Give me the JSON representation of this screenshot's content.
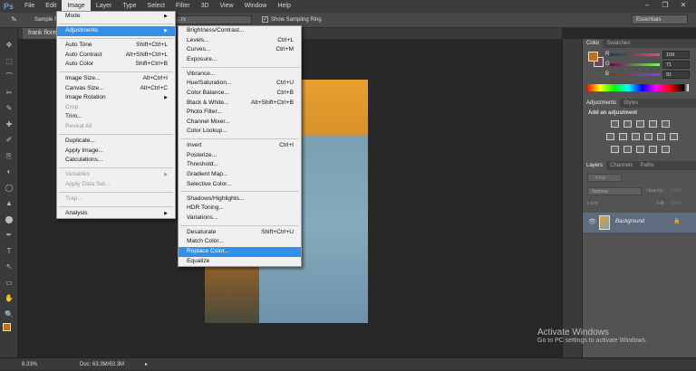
{
  "app": {
    "logo": "Ps"
  },
  "menubar": [
    "File",
    "Edit",
    "Image",
    "Layer",
    "Type",
    "Select",
    "Filter",
    "3D",
    "View",
    "Window",
    "Help"
  ],
  "options": {
    "sample_size": "Sample S",
    "sample_select": "...rs",
    "show_sampling_ring": "Show Sampling Ring",
    "workspace": "Essentials"
  },
  "document": {
    "tab": "frank flores"
  },
  "image_menu": [
    {
      "label": "Mode",
      "submenu": true
    },
    {
      "sep": true
    },
    {
      "label": "Adjustments",
      "submenu": true,
      "hl": true
    },
    {
      "sep": true
    },
    {
      "label": "Auto Tone",
      "shortcut": "Shift+Ctrl+L"
    },
    {
      "label": "Auto Contrast",
      "shortcut": "Alt+Shift+Ctrl+L"
    },
    {
      "label": "Auto Color",
      "shortcut": "Shift+Ctrl+B"
    },
    {
      "sep": true
    },
    {
      "label": "Image Size...",
      "shortcut": "Alt+Ctrl+I"
    },
    {
      "label": "Canvas Size...",
      "shortcut": "Alt+Ctrl+C"
    },
    {
      "label": "Image Rotation",
      "submenu": true
    },
    {
      "label": "Crop",
      "dis": true
    },
    {
      "label": "Trim..."
    },
    {
      "label": "Reveal All",
      "dis": true
    },
    {
      "sep": true
    },
    {
      "label": "Duplicate..."
    },
    {
      "label": "Apply Image..."
    },
    {
      "label": "Calculations..."
    },
    {
      "sep": true
    },
    {
      "label": "Variables",
      "submenu": true,
      "dis": true
    },
    {
      "label": "Apply Data Set...",
      "dis": true
    },
    {
      "sep": true
    },
    {
      "label": "Trap...",
      "dis": true
    },
    {
      "sep": true
    },
    {
      "label": "Analysis",
      "submenu": true
    }
  ],
  "adjustments_menu": [
    {
      "label": "Brightness/Contrast..."
    },
    {
      "label": "Levels...",
      "shortcut": "Ctrl+L"
    },
    {
      "label": "Curves...",
      "shortcut": "Ctrl+M"
    },
    {
      "label": "Exposure..."
    },
    {
      "sep": true
    },
    {
      "label": "Vibrance..."
    },
    {
      "label": "Hue/Saturation...",
      "shortcut": "Ctrl+U"
    },
    {
      "label": "Color Balance...",
      "shortcut": "Ctrl+B"
    },
    {
      "label": "Black & White...",
      "shortcut": "Alt+Shift+Ctrl+B"
    },
    {
      "label": "Photo Filter..."
    },
    {
      "label": "Channel Mixer..."
    },
    {
      "label": "Color Lookup..."
    },
    {
      "sep": true
    },
    {
      "label": "Invert",
      "shortcut": "Ctrl+I"
    },
    {
      "label": "Posterize..."
    },
    {
      "label": "Threshold..."
    },
    {
      "label": "Gradient Map..."
    },
    {
      "label": "Selective Color..."
    },
    {
      "sep": true
    },
    {
      "label": "Shadows/Highlights..."
    },
    {
      "label": "HDR Toning..."
    },
    {
      "label": "Variations..."
    },
    {
      "sep": true
    },
    {
      "label": "Desaturate",
      "shortcut": "Shift+Ctrl+U"
    },
    {
      "label": "Match Color..."
    },
    {
      "label": "Replace Color...",
      "hl": true
    },
    {
      "label": "Equalize"
    }
  ],
  "color_panel": {
    "tabs": [
      "Color",
      "Swatches"
    ],
    "R": "109",
    "G": "71",
    "B": "91",
    "fg": "#b8741c",
    "bg": "#6d475b"
  },
  "adjustments_panel": {
    "tabs": [
      "Adjustments",
      "Styles"
    ],
    "heading": "Add an adjustment"
  },
  "layers_panel": {
    "tabs": [
      "Layers",
      "Channels",
      "Paths"
    ],
    "kind": "Kind",
    "blend": "Normal",
    "opacity_label": "Opacity:",
    "opacity": "100%",
    "lock_label": "Lock:",
    "fill_label": "Fill:",
    "fill": "100%",
    "layer": "Background"
  },
  "status": {
    "zoom": "8.33%",
    "doc": "Doc: 63.3M/63.3M"
  },
  "watermark": {
    "title": "Activate Windows",
    "sub": "Go to PC settings to activate Windows."
  }
}
